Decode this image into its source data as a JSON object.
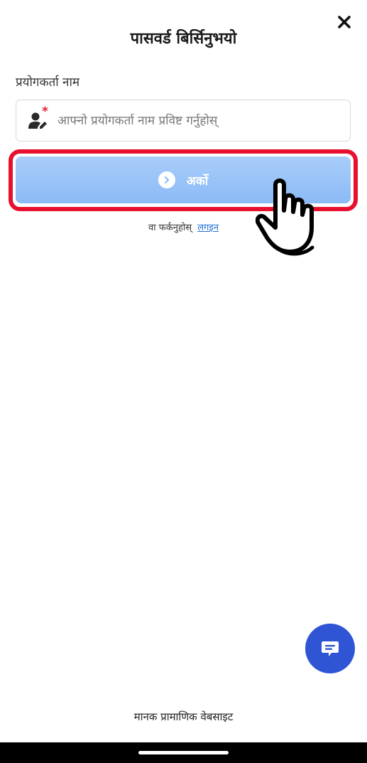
{
  "dialog": {
    "title": "पासवर्ड बिर्सिनुभयो",
    "close_icon": "close-icon"
  },
  "form": {
    "username_label": "प्रयोगकर्ता नाम",
    "username_placeholder": "आफ्नो प्रयोगकर्ता नाम प्रविष्ट गर्नुहोस्",
    "username_value": "",
    "required_marker": "*",
    "user_icon": "user-edit-icon",
    "next_button_label": "अर्को",
    "next_icon": "chevron-right-circle-icon"
  },
  "back": {
    "prefix": "वा फर्कनुहोस्",
    "login_link": "लगइन"
  },
  "overlay": {
    "highlight_color": "#e8102e",
    "pointer_icon": "hand-pointer-icon"
  },
  "chat": {
    "icon": "chat-bubble-icon",
    "color": "#2f55d4"
  },
  "footer": {
    "link_text": "मानक प्रामाणिक वेबसाइट"
  },
  "theme": {
    "button_color": "#a9cdfb",
    "link_color": "#1f6fd6"
  }
}
